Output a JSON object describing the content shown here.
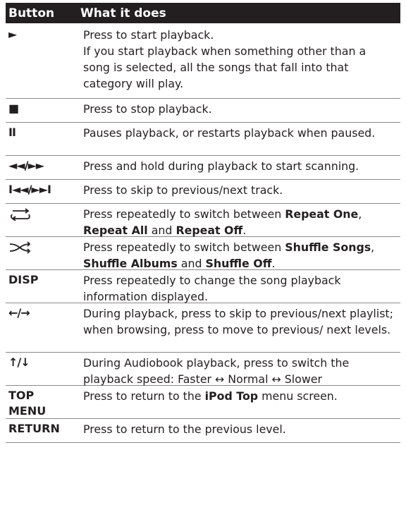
{
  "headers": {
    "button": "Button",
    "what": "What it does"
  },
  "rows": [
    {
      "button": "►",
      "icon": "play-icon",
      "desc": [
        "Press to start playback.",
        "If you start playback when something other than a song is selected, all the songs that fall into that category will play."
      ]
    },
    {
      "button": "■",
      "icon": "stop-icon",
      "desc": [
        "Press to stop playback."
      ]
    },
    {
      "button": "II",
      "icon": "pause-icon",
      "desc": [
        "Pauses playback, or restarts playback when paused."
      ]
    },
    {
      "button": "◄◄/►►",
      "icon": "scan-icon",
      "desc": [
        "Press and hold during playback to start scanning."
      ]
    },
    {
      "button": "I◄◄/►►I",
      "icon": "skip-icon",
      "desc": [
        "Press to skip to previous/next track."
      ]
    },
    {
      "button": "",
      "icon": "repeat-icon",
      "desc_parts": [
        {
          "t": "Press repeatedly to switch between ",
          "b": false
        },
        {
          "t": "Repeat One",
          "b": true
        },
        {
          "t": ", ",
          "b": false
        },
        {
          "t": "Repeat All",
          "b": true
        },
        {
          "t": " and ",
          "b": false
        },
        {
          "t": "Repeat Off",
          "b": true
        },
        {
          "t": ".",
          "b": false
        }
      ]
    },
    {
      "button": "",
      "icon": "shuffle-icon",
      "desc_parts": [
        {
          "t": "Press repeatedly to switch between ",
          "b": false
        },
        {
          "t": "Shuffle Songs",
          "b": true
        },
        {
          "t": ", ",
          "b": false
        },
        {
          "t": "Shuffle Albums",
          "b": true
        },
        {
          "t": " and ",
          "b": false
        },
        {
          "t": "Shuffle Off",
          "b": true
        },
        {
          "t": ".",
          "b": false
        }
      ]
    },
    {
      "button": "DISP",
      "icon": "",
      "desc": [
        "Press repeatedly to change the song playback information displayed."
      ]
    },
    {
      "button": "←/→",
      "icon": "left-right-arrow-icon",
      "desc": [
        "During playback, press to skip to previous/next playlist; when browsing, press to move to previous/ next levels."
      ]
    },
    {
      "button": "↑/↓",
      "icon": "up-down-arrow-icon",
      "desc": [
        "During Audiobook playback, press to switch the playback speed: Faster ↔ Normal ↔ Slower"
      ]
    },
    {
      "button": "TOP MENU",
      "icon": "",
      "desc_parts": [
        {
          "t": "Press to return to the ",
          "b": false
        },
        {
          "t": "iPod Top",
          "b": true
        },
        {
          "t": " menu screen.",
          "b": false
        }
      ]
    },
    {
      "button": "RETURN",
      "icon": "",
      "desc": [
        "Press to return to the previous level."
      ]
    }
  ]
}
